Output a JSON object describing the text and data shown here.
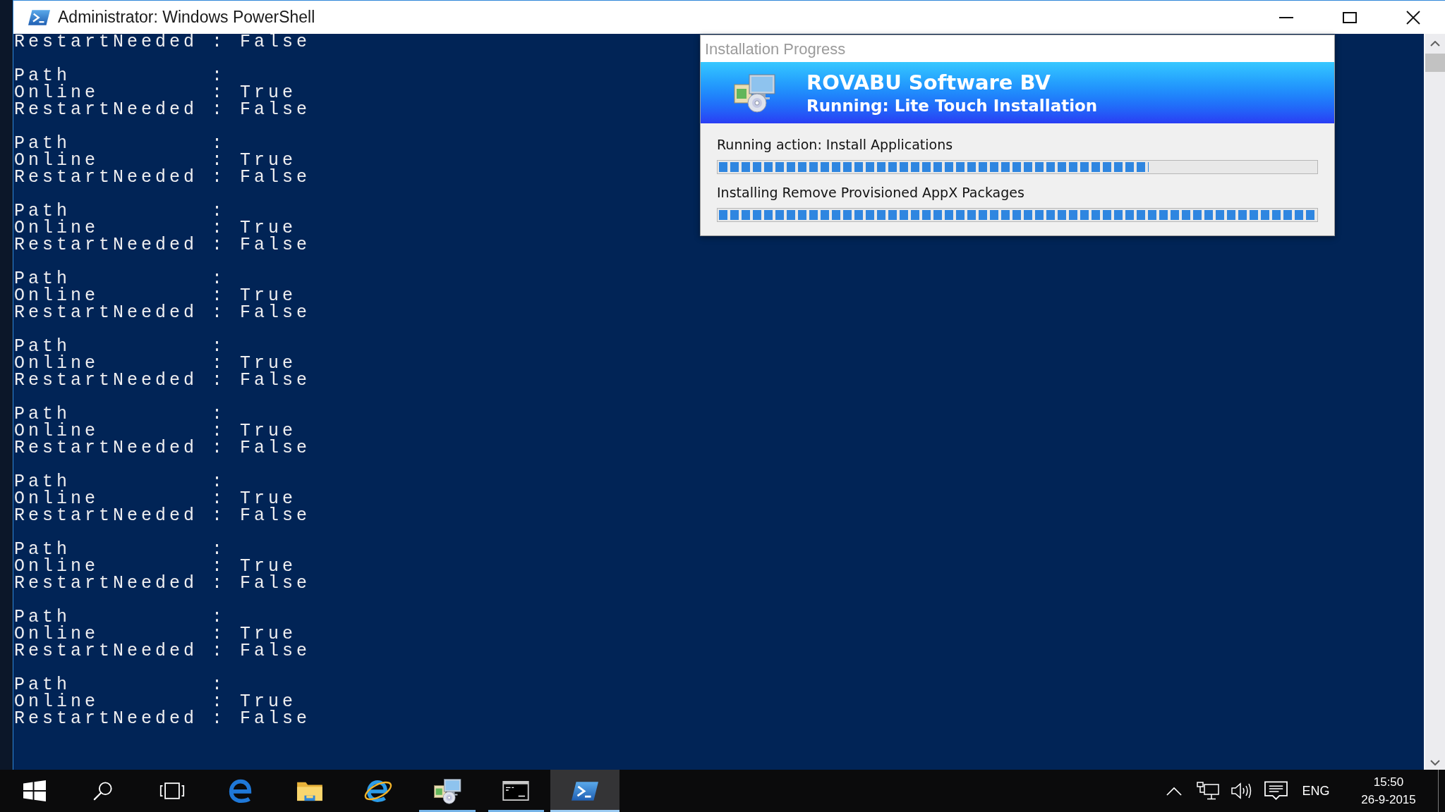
{
  "window": {
    "title": "Administrator: Windows PowerShell"
  },
  "console": {
    "blocks": [
      [
        "RestartNeeded : False"
      ],
      [
        "Path          :",
        "Online        : True",
        "RestartNeeded : False"
      ],
      [
        "Path          :",
        "Online        : True",
        "RestartNeeded : False"
      ],
      [
        "Path          :",
        "Online        : True",
        "RestartNeeded : False"
      ],
      [
        "Path          :",
        "Online        : True",
        "RestartNeeded : False"
      ],
      [
        "Path          :",
        "Online        : True",
        "RestartNeeded : False"
      ],
      [
        "Path          :",
        "Online        : True",
        "RestartNeeded : False"
      ],
      [
        "Path          :",
        "Online        : True",
        "RestartNeeded : False"
      ],
      [
        "Path          :",
        "Online        : True",
        "RestartNeeded : False"
      ],
      [
        "Path          :",
        "Online        : True",
        "RestartNeeded : False"
      ],
      [
        "Path          :",
        "Online        : True",
        "RestartNeeded : False"
      ]
    ]
  },
  "dialog": {
    "title": "Installation Progress",
    "heading": "ROVABU Software BV",
    "subheading": "Running: Lite Touch Installation",
    "tasks": [
      {
        "label": "Running action: Install Applications",
        "level": 0.72
      },
      {
        "label": "Installing Remove Provisioned AppX Packages",
        "level": 1
      }
    ]
  },
  "taskbar": {
    "buttons": [
      {
        "kind": "start",
        "running": false,
        "selected": false
      },
      {
        "kind": "search",
        "running": false,
        "selected": false
      },
      {
        "kind": "taskview",
        "running": false,
        "selected": false
      },
      {
        "kind": "edge",
        "running": false,
        "selected": false
      },
      {
        "kind": "explorer",
        "running": false,
        "selected": false
      },
      {
        "kind": "ie",
        "running": false,
        "selected": false
      },
      {
        "kind": "deployment",
        "running": true,
        "selected": false
      },
      {
        "kind": "cmd",
        "running": true,
        "selected": false
      },
      {
        "kind": "powershell",
        "running": true,
        "selected": true
      }
    ],
    "tray": {
      "language": "ENG",
      "time": "15:50",
      "date": "26-9-2015"
    }
  }
}
